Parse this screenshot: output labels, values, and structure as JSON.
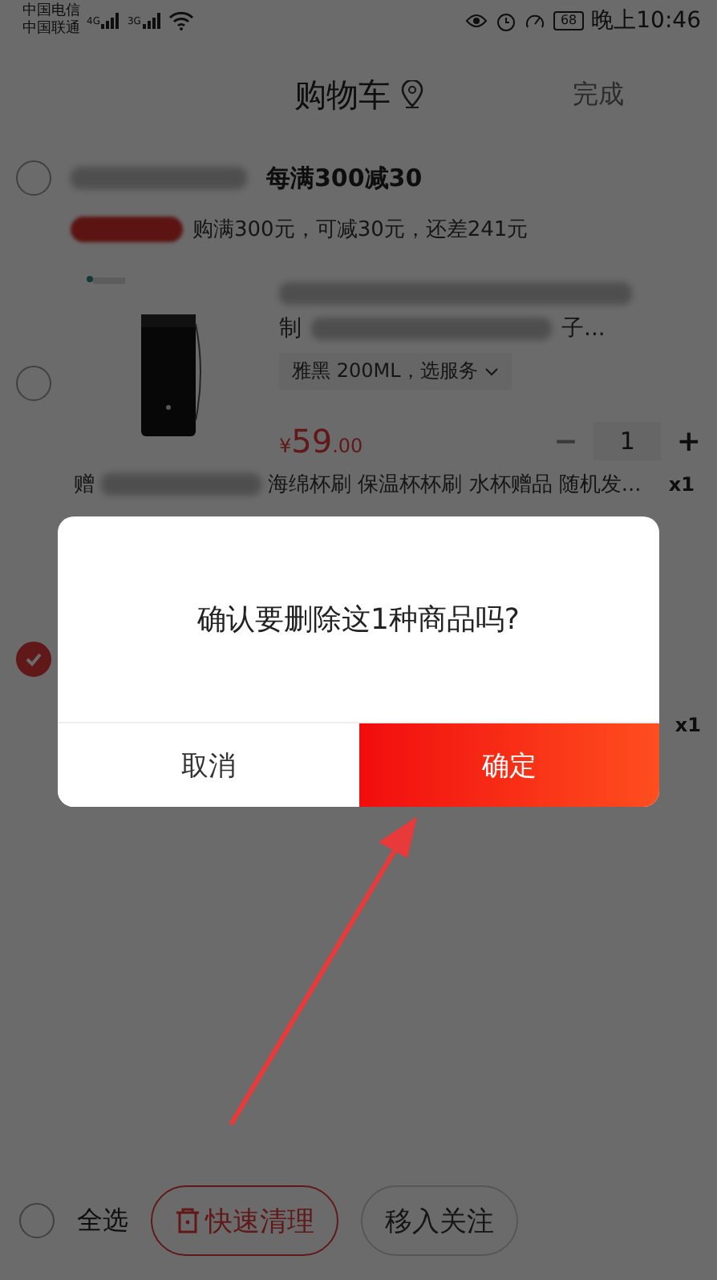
{
  "status_bar": {
    "carriers": [
      "中国电信",
      "中国联通"
    ],
    "network_labels": [
      "4G",
      "3G"
    ],
    "battery": "68",
    "time": "晚上10:46"
  },
  "header": {
    "title": "购物车",
    "action": "完成"
  },
  "shop": {
    "checked": false,
    "promo_title": "每满300减30",
    "promo_text": "购满300元，可减30元，还差241元"
  },
  "items": [
    {
      "checked": false,
      "title_fragments": [
        "制",
        "子..."
      ],
      "spec": "雅黑 200ML，选服务",
      "price_symbol": "¥",
      "price_int": "59",
      "price_dec": ".00",
      "minus": "−",
      "quantity": "1",
      "plus": "+",
      "gift_prefix": "赠",
      "gift": "海绵杯刷 保温杯杯刷 水杯赠品 随机发...",
      "gift_qty": "x1"
    },
    {
      "checked": true,
      "gift_qty": "x1"
    }
  ],
  "dialog": {
    "message": "确认要删除这1种商品吗?",
    "buttons": [
      {
        "label": "取消",
        "kind": "cancel"
      },
      {
        "label": "确定",
        "kind": "confirm"
      }
    ]
  },
  "bottom_bar": {
    "select_all": {
      "label": "全选",
      "checked": false
    },
    "buttons": [
      {
        "label": "快速清理",
        "kind": "clear"
      },
      {
        "label": "移入关注",
        "kind": "move"
      }
    ]
  }
}
